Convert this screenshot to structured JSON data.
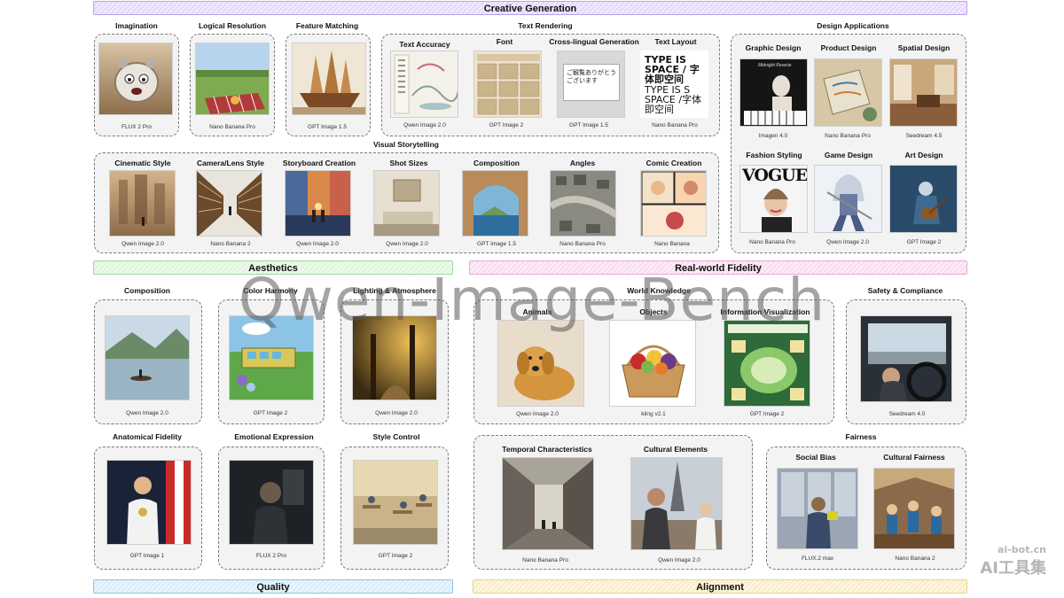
{
  "banners": {
    "creative": "Creative Generation",
    "aesthetics": "Aesthetics",
    "realworld": "Real-world Fidelity",
    "quality": "Quality",
    "alignment": "Alignment"
  },
  "groups": {
    "text_rendering": "Text Rendering",
    "design_applications": "Design Applications",
    "visual_storytelling": "Visual Storytelling",
    "world_knowledge": "World Knowledge",
    "fairness": "Fairness"
  },
  "panels": {
    "imagination": {
      "label": "Imagination",
      "model": "FLUX 2 Pro"
    },
    "logical_resolution": {
      "label": "Logical Resolution",
      "model": "Nano Banana Pro"
    },
    "feature_matching": {
      "label": "Feature Matching",
      "model": "GPT Image 1.5"
    },
    "text_accuracy": {
      "label": "Text Accuracy",
      "model": "Qwen Image 2.0"
    },
    "font": {
      "label": "Font",
      "model": "GPT Image 2"
    },
    "cross_lingual": {
      "label": "Cross-lingual Generation",
      "model": "GPT Image 1.5"
    },
    "text_layout": {
      "label": "Text Layout",
      "model": "Nano Banana Pro"
    },
    "graphic_design": {
      "label": "Graphic Design",
      "model": "Imagen 4.0"
    },
    "product_design": {
      "label": "Product Design",
      "model": "Nano Banana Pro"
    },
    "spatial_design": {
      "label": "Spatial Design",
      "model": "Seedream 4.5"
    },
    "fashion_styling": {
      "label": "Fashion Styling",
      "model": "Nano Banana Pro"
    },
    "game_design": {
      "label": "Game Design",
      "model": "Qwen Image 2.0"
    },
    "art_design": {
      "label": "Art Design",
      "model": "GPT Image 2"
    },
    "cinematic_style": {
      "label": "Cinematic Style",
      "model": "Qwen Image 2.0"
    },
    "camera_lens": {
      "label": "Camera/Lens Style",
      "model": "Nano Banana 2"
    },
    "storyboard": {
      "label": "Storyboard Creation",
      "model": "Qwen Image 2.0"
    },
    "shot_sizes": {
      "label": "Shot Sizes",
      "model": "Qwen Image 2.0"
    },
    "vs_composition": {
      "label": "Composition",
      "model": "GPT Image 1.5"
    },
    "angles": {
      "label": "Angles",
      "model": "Nano Banana Pro"
    },
    "comic_creation": {
      "label": "Comic Creation",
      "model": "Nano Banana"
    },
    "aes_composition": {
      "label": "Composition",
      "model": "Qwen Image 2.0"
    },
    "color_harmony": {
      "label": "Color Harmony",
      "model": "GPT Image 2"
    },
    "lighting": {
      "label": "Lighting & Atmosphere",
      "model": "Qwen Image 2.0"
    },
    "animals": {
      "label": "Animals",
      "model": "Qwen Image 2.0"
    },
    "objects": {
      "label": "Objects",
      "model": "kling v2.1"
    },
    "info_vis": {
      "label": "Information Visualization",
      "model": "GPT Image 2"
    },
    "safety": {
      "label": "Safety & Compliance",
      "model": "Seedream 4.0"
    },
    "anatomical": {
      "label": "Anatomical Fidelity",
      "model": "GPT Image 1"
    },
    "emotional": {
      "label": "Emotional Expression",
      "model": "FLUX 2 Pro"
    },
    "style_control": {
      "label": "Style Control",
      "model": "GPT Image 2"
    },
    "temporal": {
      "label": "Temporal Characteristics",
      "model": "Nano Banana Pro"
    },
    "cultural_elements": {
      "label": "Cultural Elements",
      "model": "Qwen Image 2.0"
    },
    "social_bias": {
      "label": "Social Bias",
      "model": "FLUX.2 max"
    },
    "cultural_fairness": {
      "label": "Cultural Fairness",
      "model": "Nano Banana 2"
    }
  },
  "image_text": {
    "text_layout": "TYPE IS SPACE / 字体即空间",
    "text_layout_2": "TYPE IS S SPACE /字体即空间",
    "cross_lingual": "ご観覧ありがとうございます",
    "fashion": "VOGUE",
    "graphic_design": "Midnight Reverie"
  },
  "watermark": "Qwen-Image-Bench",
  "corner_watermark": {
    "domain": "ai-bot.cn",
    "name": "AI工具集"
  }
}
